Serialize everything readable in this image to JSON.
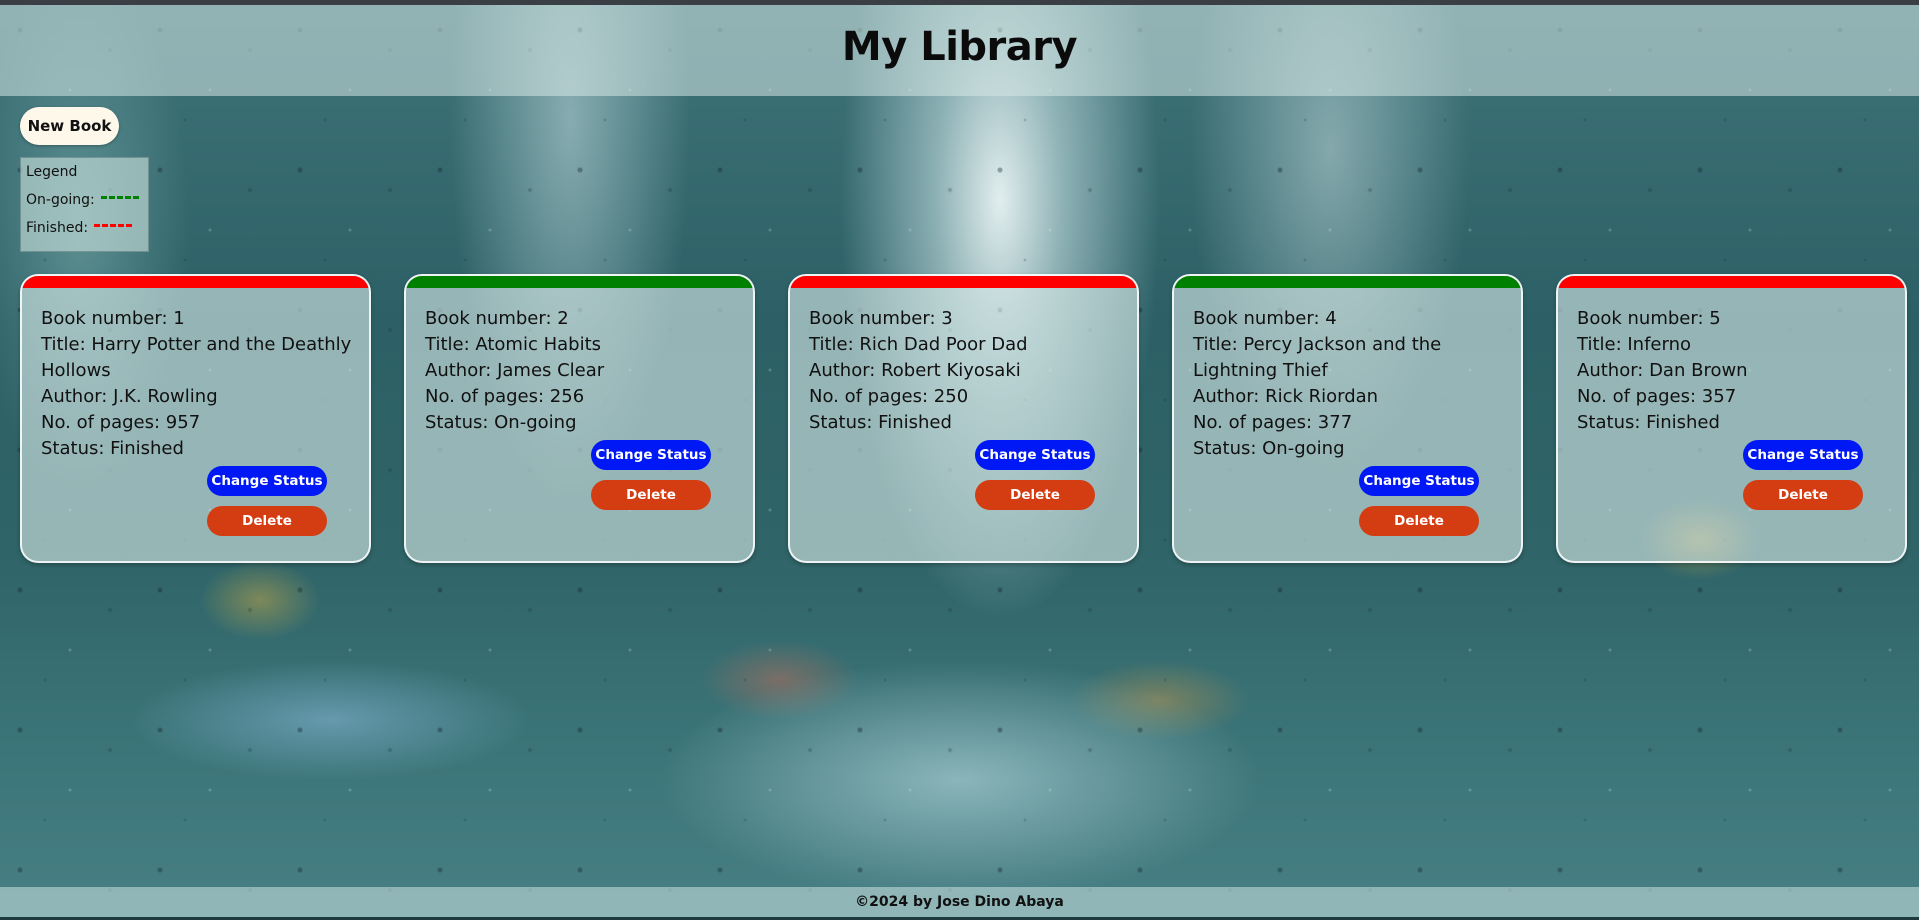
{
  "header": {
    "title": "My Library"
  },
  "toolbar": {
    "new_book_label": "New Book"
  },
  "legend": {
    "title": "Legend",
    "items": [
      {
        "label": "On-going:",
        "color": "#008000"
      },
      {
        "label": "Finished:",
        "color": "#ff0000"
      }
    ]
  },
  "colors": {
    "ongoing": "#008000",
    "finished": "#ff0000",
    "change_button": "#0018f5",
    "delete_button": "#d43d12"
  },
  "books": [
    {
      "number_text": "Book number: 1",
      "title_lines": [
        "Title: Harry Potter and the Deathly",
        "Hollows"
      ],
      "author_text": "Author: J.K. Rowling",
      "pages_text": "No. of pages: 957",
      "status_text": "Status: Finished",
      "status": "finished",
      "change_label": "Change Status",
      "delete_label": "Delete"
    },
    {
      "number_text": "Book number: 2",
      "title_lines": [
        "Title: Atomic Habits"
      ],
      "author_text": "Author: James Clear",
      "pages_text": "No. of pages: 256",
      "status_text": "Status: On-going",
      "status": "ongoing",
      "change_label": "Change Status",
      "delete_label": "Delete"
    },
    {
      "number_text": "Book number: 3",
      "title_lines": [
        "Title: Rich Dad Poor Dad"
      ],
      "author_text": "Author: Robert Kiyosaki",
      "pages_text": "No. of pages: 250",
      "status_text": "Status: Finished",
      "status": "finished",
      "change_label": "Change Status",
      "delete_label": "Delete"
    },
    {
      "number_text": "Book number: 4",
      "title_lines": [
        "Title: Percy Jackson and the",
        "Lightning Thief"
      ],
      "author_text": "Author: Rick Riordan",
      "pages_text": "No. of pages: 377",
      "status_text": "Status: On-going",
      "status": "ongoing",
      "change_label": "Change Status",
      "delete_label": "Delete"
    },
    {
      "number_text": "Book number: 5",
      "title_lines": [
        "Title: Inferno"
      ],
      "author_text": "Author: Dan Brown",
      "pages_text": "No. of pages: 357",
      "status_text": "Status: Finished",
      "status": "finished",
      "change_label": "Change Status",
      "delete_label": "Delete"
    }
  ],
  "footer": {
    "text": "©2024 by Jose Dino Abaya"
  }
}
